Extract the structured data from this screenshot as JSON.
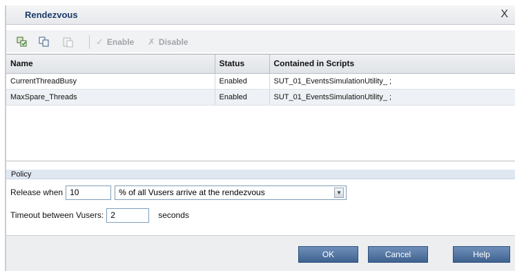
{
  "dialog": {
    "title": "Rendezvous",
    "close_glyph": "X"
  },
  "toolbar": {
    "icons": [
      "rendezvous-info-icon",
      "copy-icon",
      "paste-icon"
    ],
    "enable_label": "Enable",
    "disable_label": "Disable"
  },
  "table": {
    "columns": [
      "Name",
      "Status",
      "Contained in Scripts"
    ],
    "rows": [
      {
        "name": "CurrentThreadBusy",
        "status": "Enabled",
        "scripts": "SUT_01_EventsSimulationUtility_ ;"
      },
      {
        "name": "MaxSpare_Threads",
        "status": "Enabled",
        "scripts": "SUT_01_EventsSimulationUtility_ ;"
      }
    ]
  },
  "policy": {
    "header": "Policy",
    "release_label": "Release when",
    "release_value": "10",
    "release_option": "% of all Vusers arrive at the rendezvous",
    "timeout_label": "Timeout between Vusers:",
    "timeout_value": "2",
    "timeout_unit": "seconds"
  },
  "footer": {
    "ok": "OK",
    "cancel": "Cancel",
    "help": "Help"
  },
  "colors": {
    "title": "#1b3c6b",
    "button": "#4f6f99"
  }
}
